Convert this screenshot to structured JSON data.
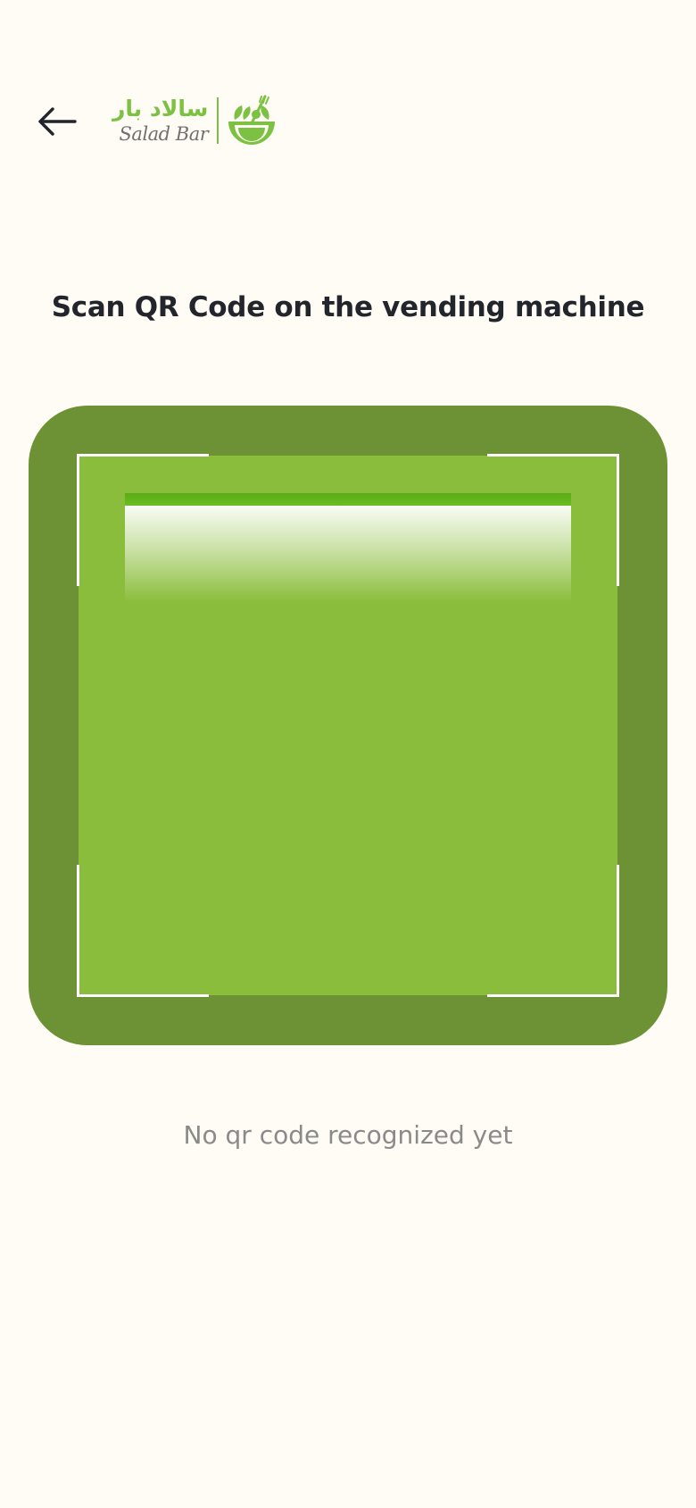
{
  "header": {
    "back_icon": "arrow-left-icon",
    "logo": {
      "arabic_name": "سالاد بار",
      "english_name": "Salad Bar",
      "mark_icon": "salad-bowl-icon",
      "brand_color": "#7cc142"
    }
  },
  "main": {
    "title": "Scan QR Code on the vending machine",
    "scanner": {
      "frame_color": "#6c9235",
      "camera_color": "#8bbd3c",
      "scan_line_color": "#5aab14"
    },
    "status": "No qr code recognized yet"
  }
}
